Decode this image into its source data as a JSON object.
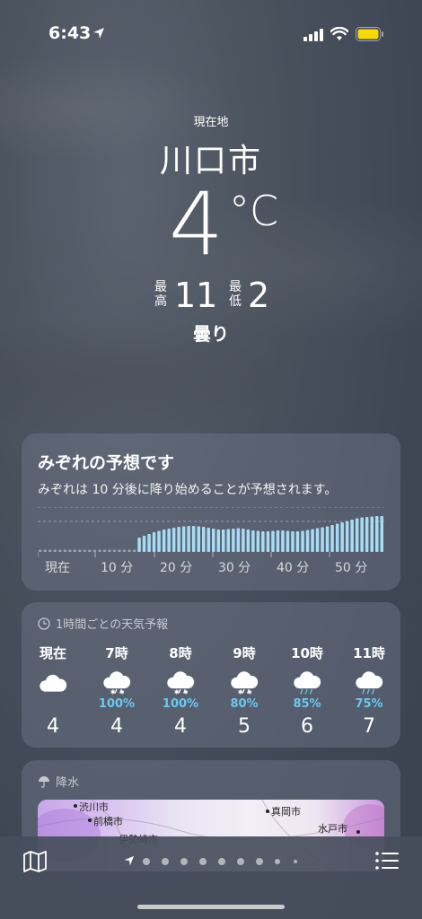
{
  "status_bar": {
    "time": "6:43"
  },
  "header": {
    "location_label": "現在地",
    "city": "川口市",
    "temperature": "4",
    "unit": "°C",
    "high_label": "最高",
    "high": "11",
    "low_label": "最低",
    "low": "2",
    "condition": "曇り"
  },
  "precip_card": {
    "title": "みぞれの予想です",
    "description": "みぞれは 10 分後に降り始めることが予想されます。",
    "ticks": [
      "現在",
      "10 分",
      "20 分",
      "30 分",
      "40 分",
      "50 分"
    ],
    "intensity": [
      0.05,
      0.05,
      0.05,
      0.05,
      0.05,
      0.05,
      0.05,
      0.05,
      0.05,
      0.05,
      0.05,
      0.05,
      0.05,
      0.05,
      0.05,
      0.05,
      0.05,
      0.05,
      0.05,
      0.05,
      0.32,
      0.36,
      0.4,
      0.44,
      0.47,
      0.5,
      0.52,
      0.54,
      0.56,
      0.57,
      0.58,
      0.58,
      0.57,
      0.56,
      0.54,
      0.52,
      0.5,
      0.5,
      0.51,
      0.52,
      0.53,
      0.52,
      0.5,
      0.48,
      0.47,
      0.46,
      0.46,
      0.47,
      0.48,
      0.48,
      0.47,
      0.46,
      0.46,
      0.47,
      0.49,
      0.51,
      0.53,
      0.55,
      0.57,
      0.6,
      0.63,
      0.66,
      0.69,
      0.72,
      0.75,
      0.77,
      0.78,
      0.79,
      0.8,
      0.8
    ]
  },
  "hourly_card": {
    "title": "1時間ごとの天気予報",
    "hours": [
      {
        "label": "現在",
        "icon": "cloud-icon",
        "pct": "",
        "temp": "4"
      },
      {
        "label": "7時",
        "icon": "sleet-icon",
        "pct": "100%",
        "temp": "4"
      },
      {
        "label": "8時",
        "icon": "sleet-icon",
        "pct": "100%",
        "temp": "4"
      },
      {
        "label": "9時",
        "icon": "sleet-icon",
        "pct": "80%",
        "temp": "5"
      },
      {
        "label": "10時",
        "icon": "rain-icon",
        "pct": "85%",
        "temp": "6"
      },
      {
        "label": "11時",
        "icon": "rain-icon",
        "pct": "75%",
        "temp": "7"
      }
    ]
  },
  "precip_map_card": {
    "title": "降水",
    "map_labels": [
      "渋川市",
      "前橋市",
      "真岡市",
      "水戸市",
      "伊勢崎市"
    ]
  },
  "colors": {
    "accent_precip": "#6cc8f0",
    "battery": "#f5d90a"
  }
}
